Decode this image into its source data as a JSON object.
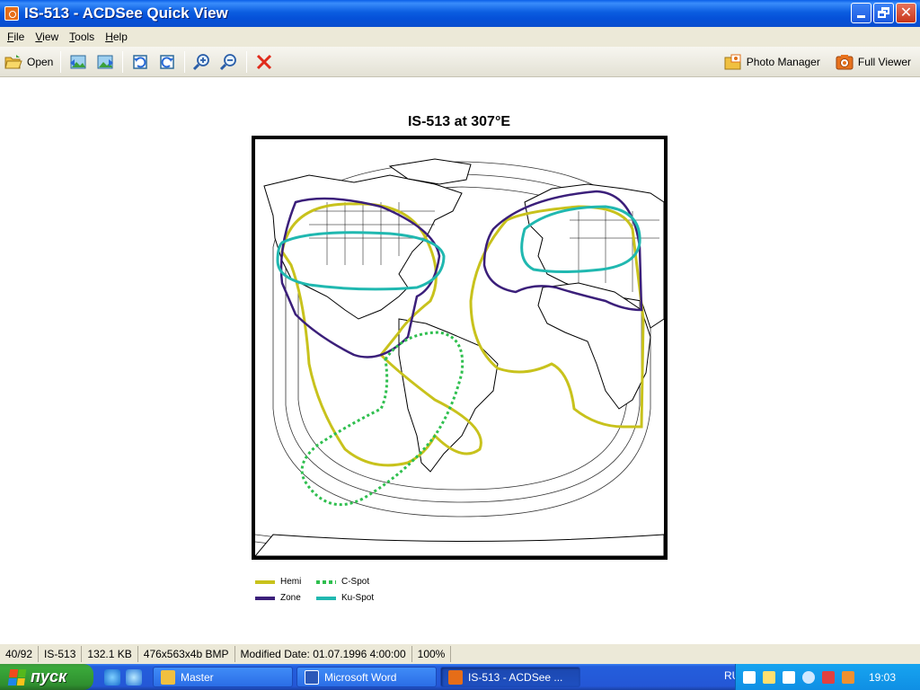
{
  "window": {
    "title": "IS-513 - ACDSee Quick View"
  },
  "menu": [
    {
      "label": "File",
      "accel": "F",
      "rest": "ile"
    },
    {
      "label": "View",
      "accel": "V",
      "rest": "iew"
    },
    {
      "label": "Tools",
      "accel": "T",
      "rest": "ools"
    },
    {
      "label": "Help",
      "accel": "H",
      "rest": "elp"
    }
  ],
  "toolbar": {
    "open_label": "Open",
    "photo_manager_label": "Photo Manager",
    "full_viewer_label": "Full Viewer"
  },
  "image": {
    "title": "IS-513 at 307°E",
    "legend": [
      {
        "label": "Hemi",
        "color": "#c8c21c",
        "style": "solid"
      },
      {
        "label": "C-Spot",
        "color": "#2fbf4f",
        "style": "dotted"
      },
      {
        "label": "Zone",
        "color": "#3b1f7a",
        "style": "solid"
      },
      {
        "label": "Ku-Spot",
        "color": "#20b8b0",
        "style": "solid"
      }
    ]
  },
  "status": {
    "position": "40/92",
    "name": "IS-513",
    "size": "132.1 KB",
    "dims": "476x563x4b BMP",
    "modified": "Modified Date: 01.07.1996 4:00:00",
    "zoom": "100%"
  },
  "taskbar": {
    "start_label": "пуск",
    "tasks": [
      {
        "label": "Master"
      },
      {
        "label": "Microsoft Word"
      },
      {
        "label": "IS-513 - ACDSee ..."
      }
    ],
    "lang": "RU",
    "clock": "19:03"
  }
}
